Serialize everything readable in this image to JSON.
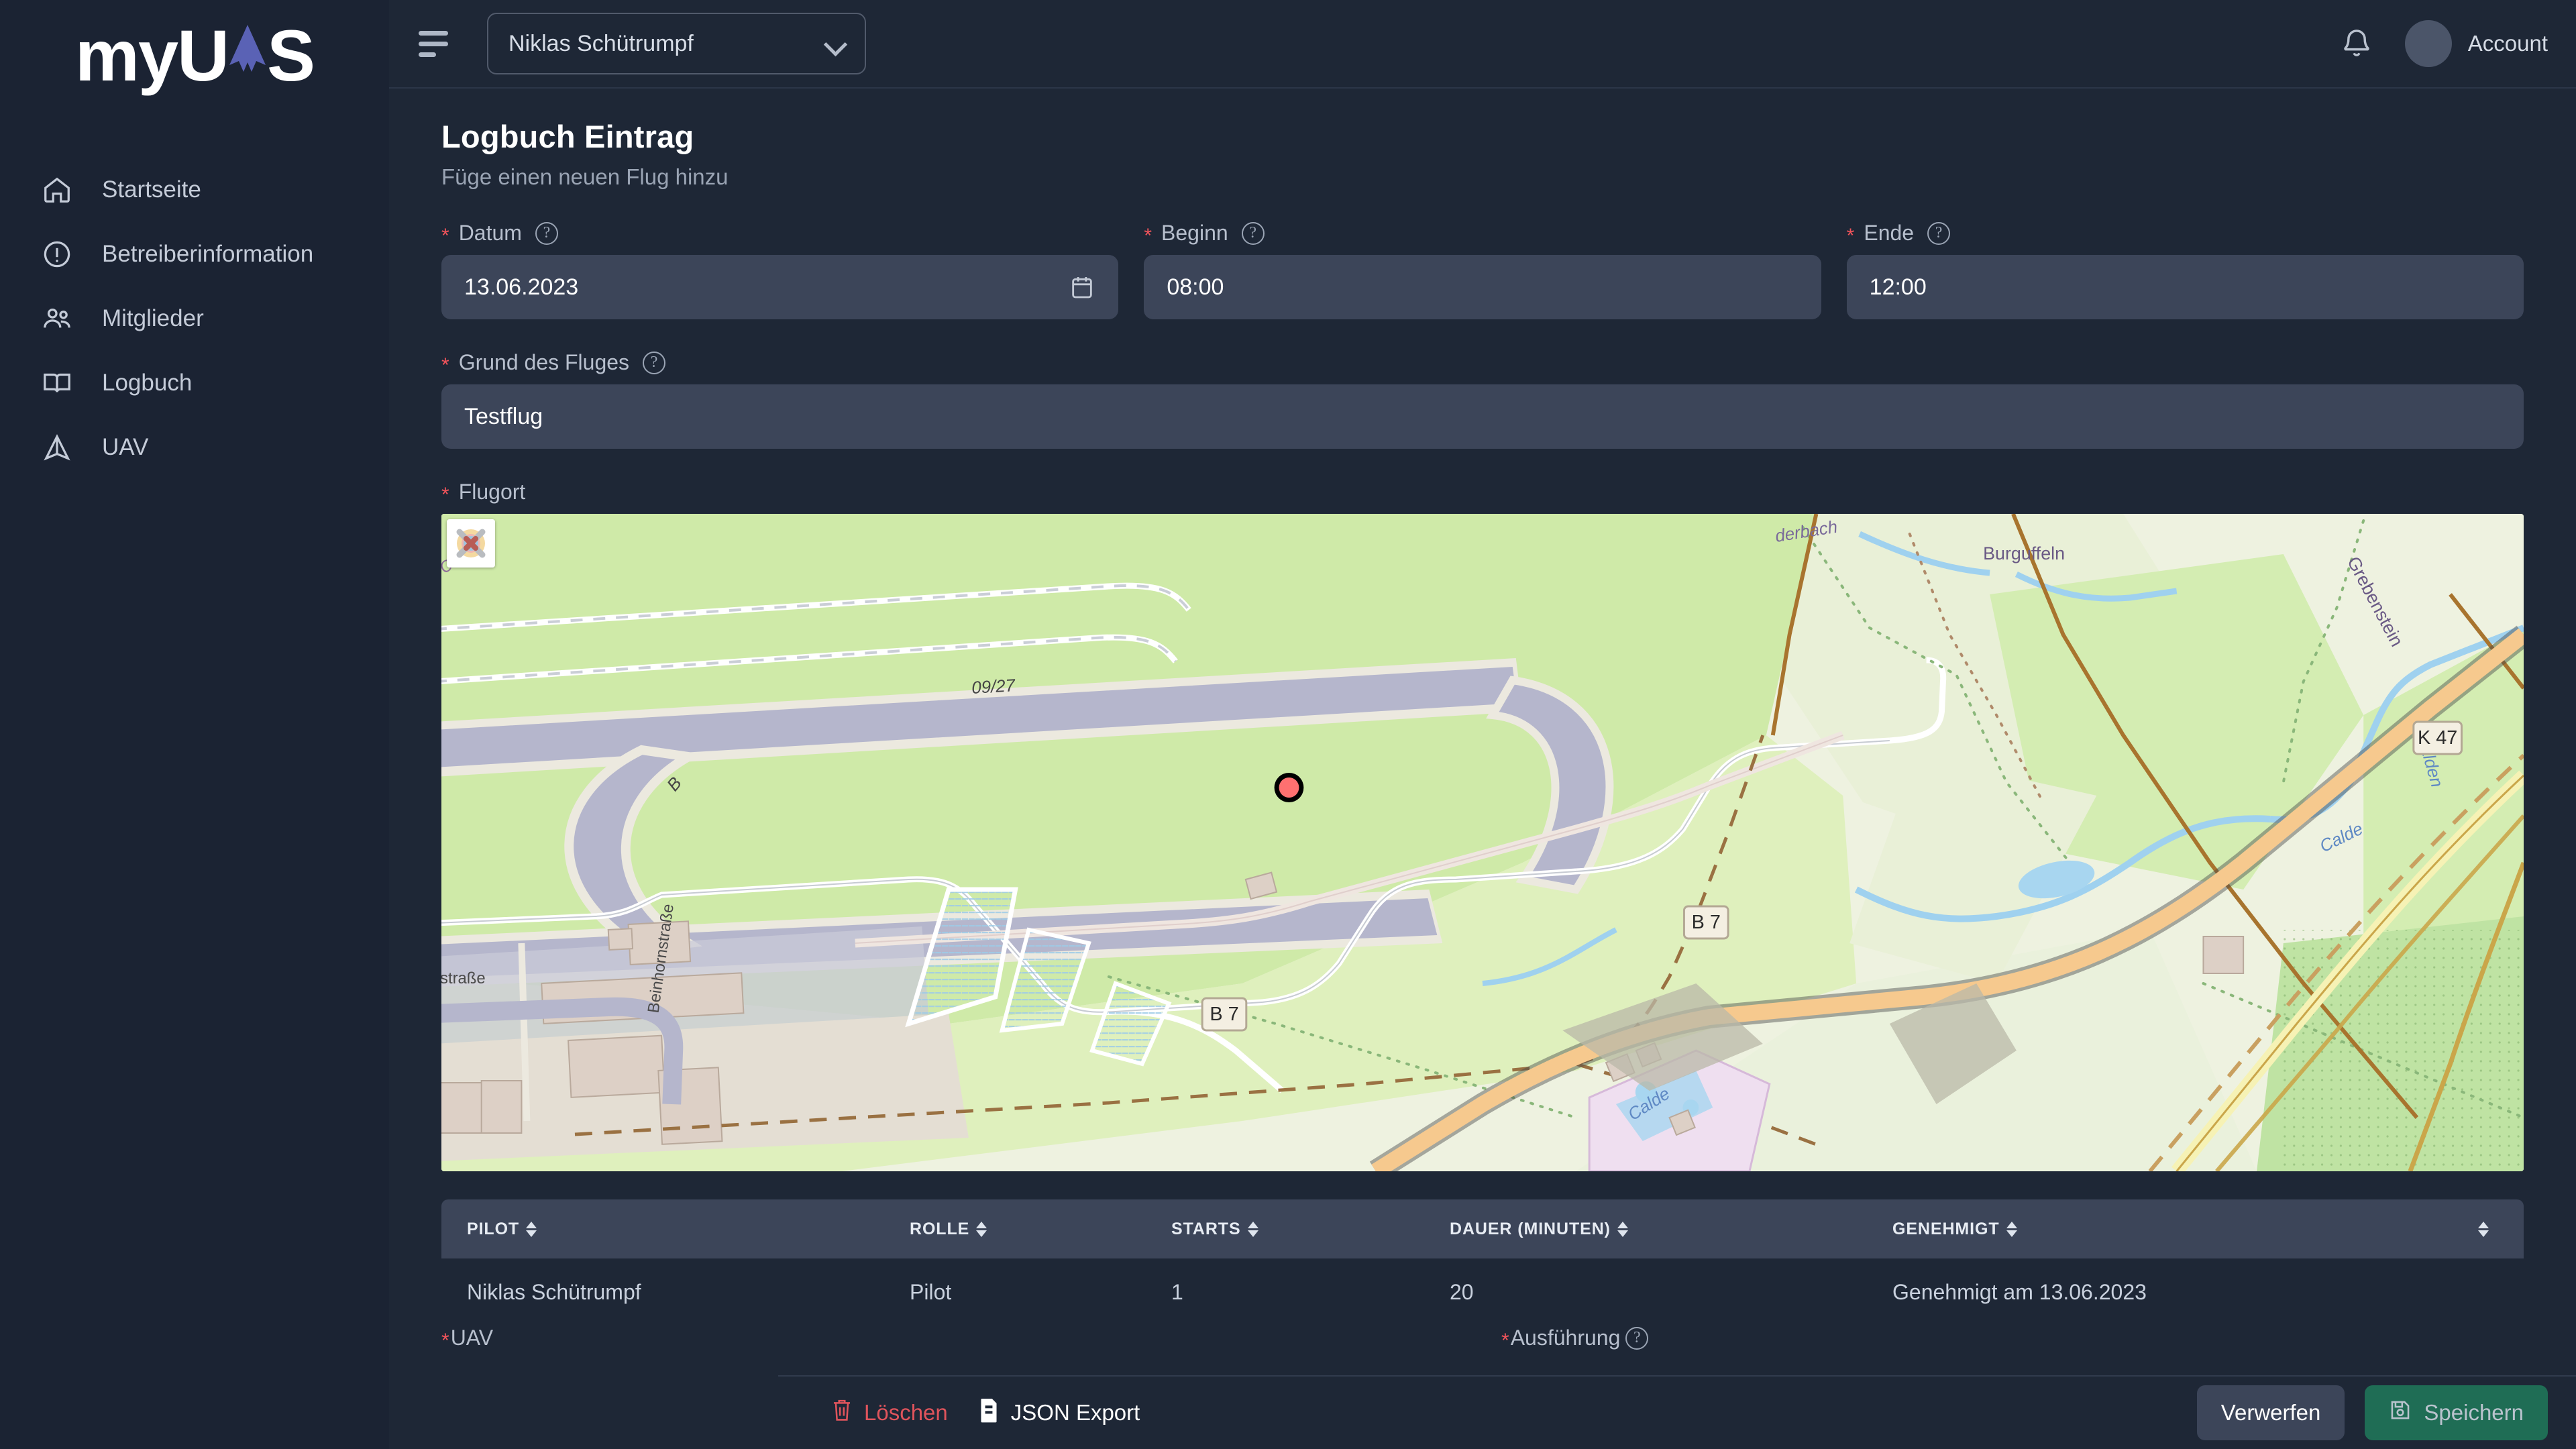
{
  "brand": {
    "name_part1": "myU",
    "name_part2": "S",
    "drone_color": "#5a62b5"
  },
  "sidebar": {
    "items": [
      {
        "label": "Startseite",
        "icon": "home-icon"
      },
      {
        "label": "Betreiberinformation",
        "icon": "info-circle-icon"
      },
      {
        "label": "Mitglieder",
        "icon": "users-icon"
      },
      {
        "label": "Logbuch",
        "icon": "book-icon"
      },
      {
        "label": "UAV",
        "icon": "drone-triangle-icon"
      }
    ]
  },
  "topbar": {
    "menu_icon": "hamburger-icon",
    "org_selected": "Niklas Schütrumpf",
    "notifications_icon": "bell-icon",
    "account_label": "Account"
  },
  "page": {
    "title": "Logbuch Eintrag",
    "subtitle": "Füge einen neuen Flug hinzu"
  },
  "form": {
    "datum": {
      "label": "Datum",
      "value": "13.06.2023",
      "required": true,
      "help": "?",
      "icon": "calendar-icon"
    },
    "beginn": {
      "label": "Beginn",
      "value": "08:00",
      "required": true,
      "help": "?"
    },
    "ende": {
      "label": "Ende",
      "value": "12:00",
      "required": true,
      "help": "?"
    },
    "grund": {
      "label": "Grund des Fluges",
      "value": "Testflug",
      "required": true,
      "help": "?"
    },
    "flugort": {
      "label": "Flugort",
      "required": true
    },
    "uav": {
      "label": "UAV",
      "required": true
    },
    "ausfuehrung": {
      "label": "Ausführung",
      "required": true,
      "help": "?"
    }
  },
  "map": {
    "layers_button_icon": "map-layers-icon",
    "marker": {
      "type": "flight-location-marker",
      "fill": "#ff6b6b",
      "stroke": "#000000"
    },
    "labels": [
      {
        "text": "09/27",
        "kind": "runway"
      },
      {
        "text": "B",
        "kind": "taxiway"
      },
      {
        "text": "Calden",
        "kind": "place"
      },
      {
        "text": "Beinhornstraße",
        "kind": "street"
      },
      {
        "text": "straße",
        "kind": "street"
      },
      {
        "text": "Burguffeln",
        "kind": "place"
      },
      {
        "text": "Grebenstein",
        "kind": "place"
      },
      {
        "text": "Calde",
        "kind": "water"
      },
      {
        "text": "Calden",
        "kind": "water"
      },
      {
        "text": "derbach",
        "kind": "water"
      },
      {
        "text": "B 7",
        "kind": "road-shield"
      },
      {
        "text": "B 7",
        "kind": "road-shield"
      },
      {
        "text": "K 47",
        "kind": "road-shield"
      }
    ]
  },
  "table": {
    "columns": [
      {
        "key": "pilot",
        "label": "PILOT",
        "sortable": true
      },
      {
        "key": "rolle",
        "label": "ROLLE",
        "sortable": true
      },
      {
        "key": "starts",
        "label": "STARTS",
        "sortable": true
      },
      {
        "key": "dauer",
        "label": "DAUER (MINUTEN)",
        "sortable": true
      },
      {
        "key": "genehmigt",
        "label": "GENEHMIGT",
        "sortable": true
      },
      {
        "key": "actions",
        "label": "",
        "sortable": true
      }
    ],
    "rows": [
      {
        "pilot": "Niklas Schütrumpf",
        "rolle": "Pilot",
        "starts": "1",
        "dauer": "20",
        "genehmigt": "Genehmigt am 13.06.2023"
      }
    ]
  },
  "bottombar": {
    "delete_label": "Löschen",
    "delete_icon": "trash-icon",
    "json_export_label": "JSON Export",
    "json_export_icon": "file-icon",
    "discard_label": "Verwerfen",
    "save_label": "Speichern",
    "save_icon": "floppy-disk-icon"
  },
  "colors": {
    "sidebar_bg": "#1b2333",
    "main_bg": "#1e2736",
    "input_bg": "#3c4559",
    "accent_required": "#f2545b",
    "save_green": "#1f6d55",
    "delete_red": "#e0545c"
  }
}
